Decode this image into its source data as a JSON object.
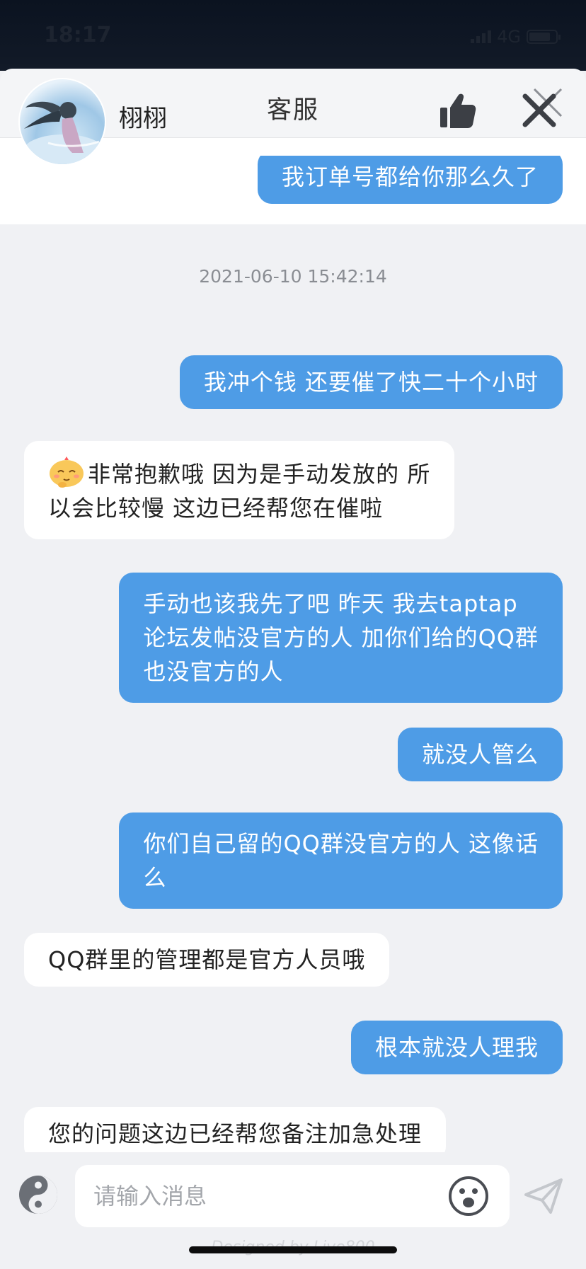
{
  "status": {
    "time": "18:17",
    "network": "4G"
  },
  "header": {
    "title": "客服"
  },
  "agent": {
    "name": "栩栩"
  },
  "messages": [
    {
      "side": "me",
      "text": "我订单号都给你那么久了"
    },
    {
      "side": "time",
      "text": "2021-06-10 15:42:14"
    },
    {
      "side": "me",
      "text": "我冲个钱  还要催了快二十个小时"
    },
    {
      "side": "them",
      "line1": "非常抱歉哦  因为是手动发放的 所",
      "line2": "以会比较慢 这边已经帮您在催啦"
    },
    {
      "side": "me",
      "line1": "手动也该我先了吧   昨天   我去taptap",
      "line2": "论坛发帖没官方的人 加你们给的QQ群",
      "line3": "也没官方的人"
    },
    {
      "side": "me",
      "text": "就没人管么"
    },
    {
      "side": "me",
      "line1": "你们自己留的QQ群没官方的人  这像话",
      "line2": "么"
    },
    {
      "side": "them",
      "text": "QQ群里的管理都是官方人员哦"
    },
    {
      "side": "me",
      "text": "根本就没人理我"
    },
    {
      "side": "them",
      "text": "您的问题这边已经帮您备注加急处理"
    }
  ],
  "input": {
    "placeholder": "请输入消息",
    "value": ""
  },
  "footer": {
    "credit": "Designed by Live800"
  },
  "colors": {
    "outgoing_bubble": "#4e9ce6",
    "incoming_bubble": "#ffffff",
    "background": "#f0f1f4"
  }
}
